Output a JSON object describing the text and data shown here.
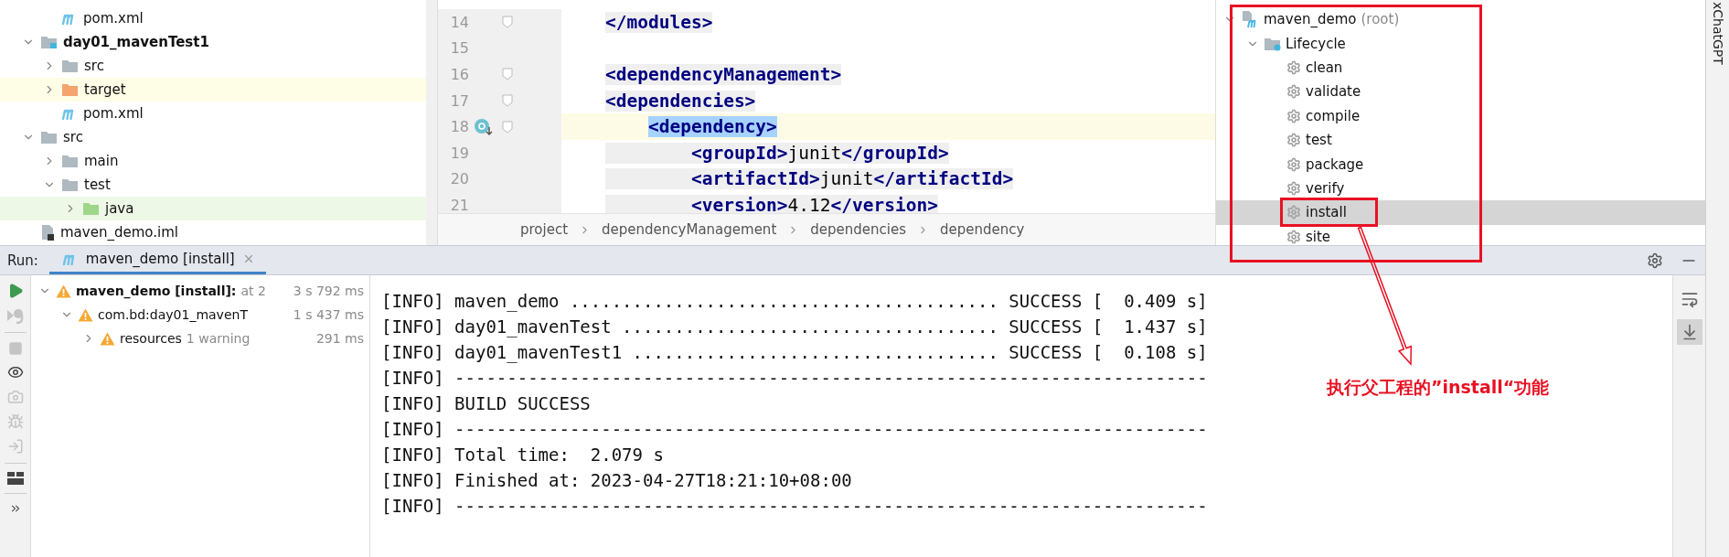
{
  "project_tree": {
    "items_above": [
      {
        "label": "pom.xml",
        "kind": "maven"
      }
    ],
    "items": [
      {
        "label": "day01_mavenTest1",
        "kind": "module",
        "bold": true,
        "expanded": true,
        "children": [
          {
            "label": "src",
            "kind": "folder",
            "expanded": false
          },
          {
            "label": "target",
            "kind": "excluded",
            "expanded": false
          },
          {
            "label": "pom.xml",
            "kind": "maven"
          }
        ]
      },
      {
        "label": "src",
        "kind": "folder",
        "bold": false,
        "expanded": true,
        "children": [
          {
            "label": "main",
            "kind": "folder",
            "expanded": false
          },
          {
            "label": "test",
            "kind": "folder",
            "expanded": true,
            "children": [
              {
                "label": "java",
                "kind": "test_sources",
                "expanded": false
              }
            ]
          }
        ]
      },
      {
        "label": "maven_demo.iml",
        "kind": "iml"
      }
    ]
  },
  "editor": {
    "lines": [
      {
        "number": "14",
        "code": "</modules>",
        "current": false,
        "fold": true,
        "marker": false
      },
      {
        "number": "15",
        "current": false,
        "fold": false,
        "marker": false
      },
      {
        "number": "16",
        "code": "<dependencyManagement>",
        "current": false,
        "fold": true,
        "marker": false
      },
      {
        "number": "17",
        "code": "<dependencies>",
        "current": false,
        "fold": true,
        "marker": false
      },
      {
        "number": "18",
        "code": "    <dependency>",
        "current": true,
        "fold": true,
        "marker": true,
        "match_highlight": true
      },
      {
        "number": "19",
        "code": "        <groupId>junit</groupId>",
        "current": false,
        "fold": false,
        "marker": false
      },
      {
        "number": "20",
        "code": "        <artifactId>junit</artifactId>",
        "current": false,
        "fold": false,
        "marker": false
      },
      {
        "number": "21",
        "code": "        <version>4.12</version>",
        "current": false,
        "fold": false,
        "marker": false
      }
    ],
    "breadcrumbs": [
      "project",
      "dependencyManagement",
      "dependencies",
      "dependency"
    ]
  },
  "maven_tree": {
    "items": [
      {
        "label": "maven_demo",
        "note": "(root)",
        "kind": "project",
        "expanded": true,
        "children": [
          {
            "label": "Lifecycle",
            "kind": "lifecycle",
            "expanded": true,
            "children": [
              {
                "label": "clean",
                "kind": "goal",
                "selected": false
              },
              {
                "label": "validate",
                "kind": "goal",
                "selected": false
              },
              {
                "label": "compile",
                "kind": "goal",
                "selected": false
              },
              {
                "label": "test",
                "kind": "goal",
                "selected": false
              },
              {
                "label": "package",
                "kind": "goal",
                "selected": false
              },
              {
                "label": "verify",
                "kind": "goal",
                "selected": false
              },
              {
                "label": "install",
                "kind": "goal",
                "selected": true
              },
              {
                "label": "site",
                "kind": "goal",
                "selected": false
              }
            ]
          }
        ]
      }
    ]
  },
  "side_stripe": {
    "label": "xChatGPT"
  },
  "run": {
    "title": "Run:",
    "tab": {
      "label": "maven_demo [install]",
      "selected": true
    },
    "tree": [
      {
        "label": "maven_demo [install]:",
        "detail": "at 2",
        "time": "3 s 792 ms",
        "bold": true,
        "expanded": true,
        "children": [
          {
            "label": "com.bd:day01_mavenT",
            "time": "1 s 437 ms",
            "bold": false,
            "expanded": true,
            "children": [
              {
                "label": "resources",
                "detail": "1 warning",
                "time": "291 ms",
                "bold": false,
                "expanded": false
              }
            ]
          }
        ]
      }
    ],
    "console": [
      "[INFO] maven_demo ......................................... SUCCESS [  0.409 s]",
      "[INFO] day01_mavenTest .................................... SUCCESS [  1.437 s]",
      "[INFO] day01_mavenTest1 ................................... SUCCESS [  0.108 s]",
      "[INFO] ------------------------------------------------------------------------",
      "[INFO] BUILD SUCCESS",
      "[INFO] ------------------------------------------------------------------------",
      "[INFO] Total time:  2.079 s",
      "[INFO] Finished at: 2023-04-27T18:21:10+08:00",
      "[INFO] ------------------------------------------------------------------------"
    ]
  },
  "annotation": {
    "text": "执行父工程的”install“功能"
  }
}
